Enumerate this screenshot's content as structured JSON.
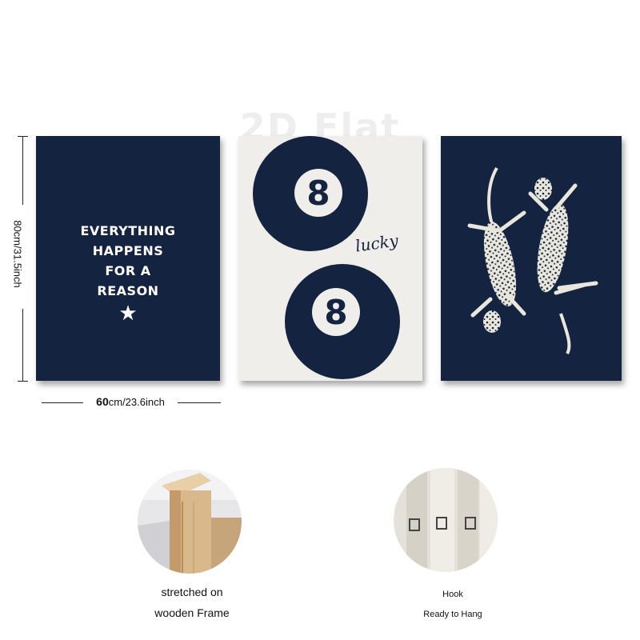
{
  "watermark": "2D Flat",
  "dimensions": {
    "height_label": "80cm/31.5inch",
    "width_num": "60",
    "width_rest": "cm/23.6inch"
  },
  "posters": {
    "quote_lines": [
      "EVERYTHING",
      "HAPPENS",
      "FOR A",
      "REASON"
    ],
    "star": "★",
    "ball_number": "8",
    "lucky_text": "lucky"
  },
  "features": {
    "frame_caption_1": "stretched on",
    "frame_caption_2": "wooden Frame",
    "hook_caption": "Hook",
    "hang_caption": "Ready to Hang"
  },
  "colors": {
    "navy": "#142340",
    "cream": "#efeeea",
    "wood": "#d9b88c"
  }
}
